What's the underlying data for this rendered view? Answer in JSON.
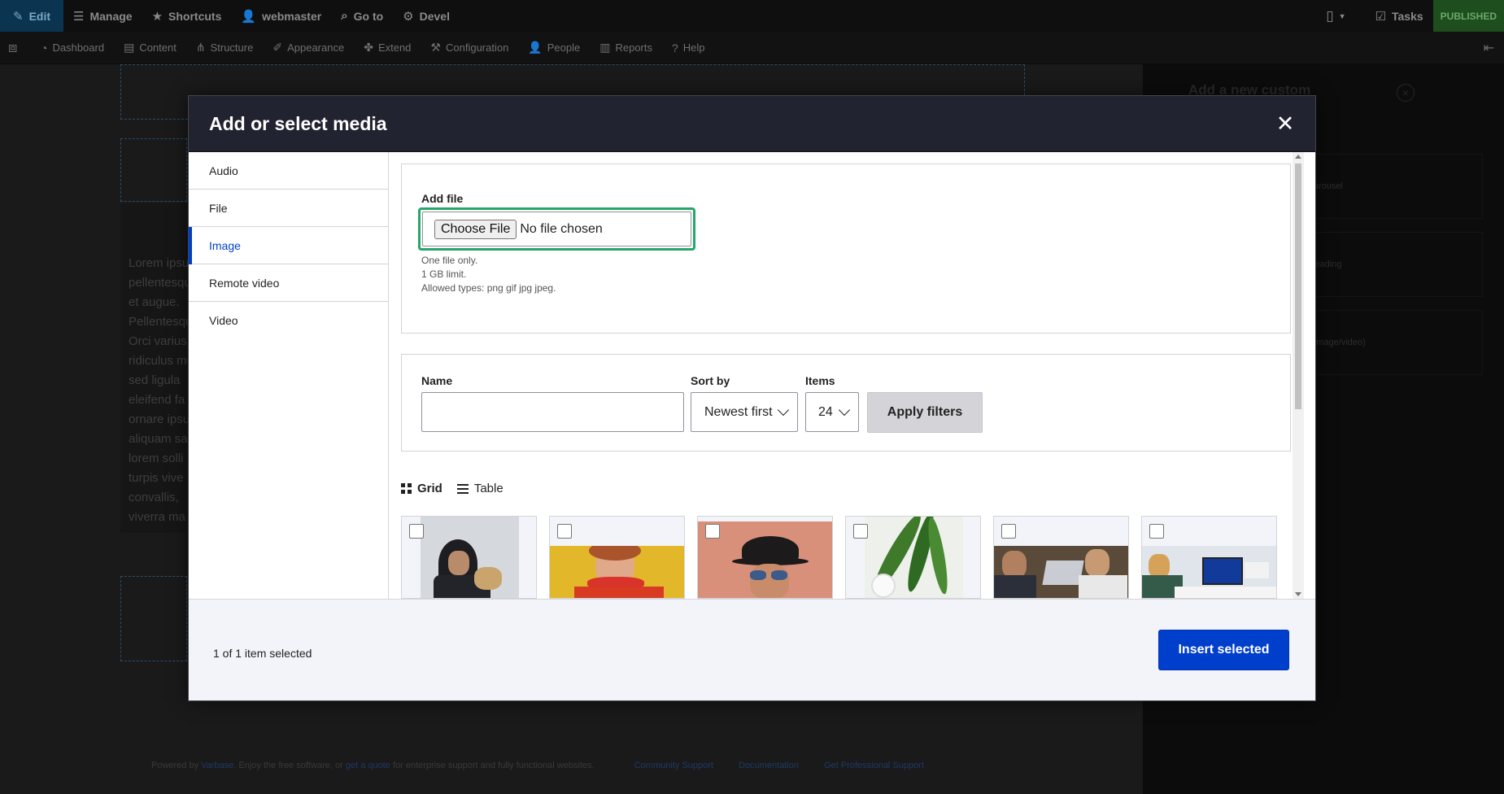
{
  "toolbar": {
    "edit": "Edit",
    "manage": "Manage",
    "shortcuts": "Shortcuts",
    "user": "webmaster",
    "goto": "Go to",
    "devel": "Devel",
    "tasks": "Tasks",
    "published": "PUBLISHED"
  },
  "admin_menu": {
    "items": [
      "Dashboard",
      "Content",
      "Structure",
      "Appearance",
      "Extend",
      "Configuration",
      "People",
      "Reports",
      "Help"
    ]
  },
  "background": {
    "lorem_lines": [
      "Lorem ipsum",
      "pellentesque",
      "et augue.",
      "Pellentesque",
      "Orci varius",
      "ridiculus mus",
      "sed ligula",
      "eleifend fa",
      "ornare ipsum",
      "aliquam sa",
      "lorem solli",
      "turpis vive",
      "convallis,",
      "viverra ma"
    ],
    "side_panel_title": "Add a new custom",
    "side_panel_items": [
      "Carousel",
      "Heading",
      "Media (image/video)"
    ],
    "footer_powered": "Powered by",
    "footer_varbase": "Varbase",
    "footer_mid": ". Enjoy the free software, or",
    "footer_quote": "get a quote",
    "footer_rest": "for enterprise support and fully functional websites.",
    "footer_links": [
      "Community Support",
      "Documentation",
      "Get Professional Support"
    ]
  },
  "modal": {
    "title": "Add or select media",
    "close_glyph": "✕",
    "tabs": [
      "Audio",
      "File",
      "Image",
      "Remote video",
      "Video"
    ],
    "active_tab": "Image",
    "upload": {
      "label": "Add file",
      "button": "Choose File",
      "status": "No file chosen",
      "help": [
        "One file only.",
        "1 GB limit.",
        "Allowed types: png gif jpg jpeg."
      ]
    },
    "filters": {
      "name_label": "Name",
      "name_value": "",
      "sort_label": "Sort by",
      "sort_value": "Newest first",
      "items_label": "Items",
      "items_value": "24",
      "apply": "Apply filters"
    },
    "views": {
      "grid": "Grid",
      "table": "Table"
    },
    "footer": {
      "selected": "1 of 1 item selected",
      "insert": "Insert selected"
    }
  },
  "colors": {
    "accent": "#003ecc",
    "focus": "#26a769",
    "modal_header": "#222330",
    "published": "#1e4d1e"
  }
}
